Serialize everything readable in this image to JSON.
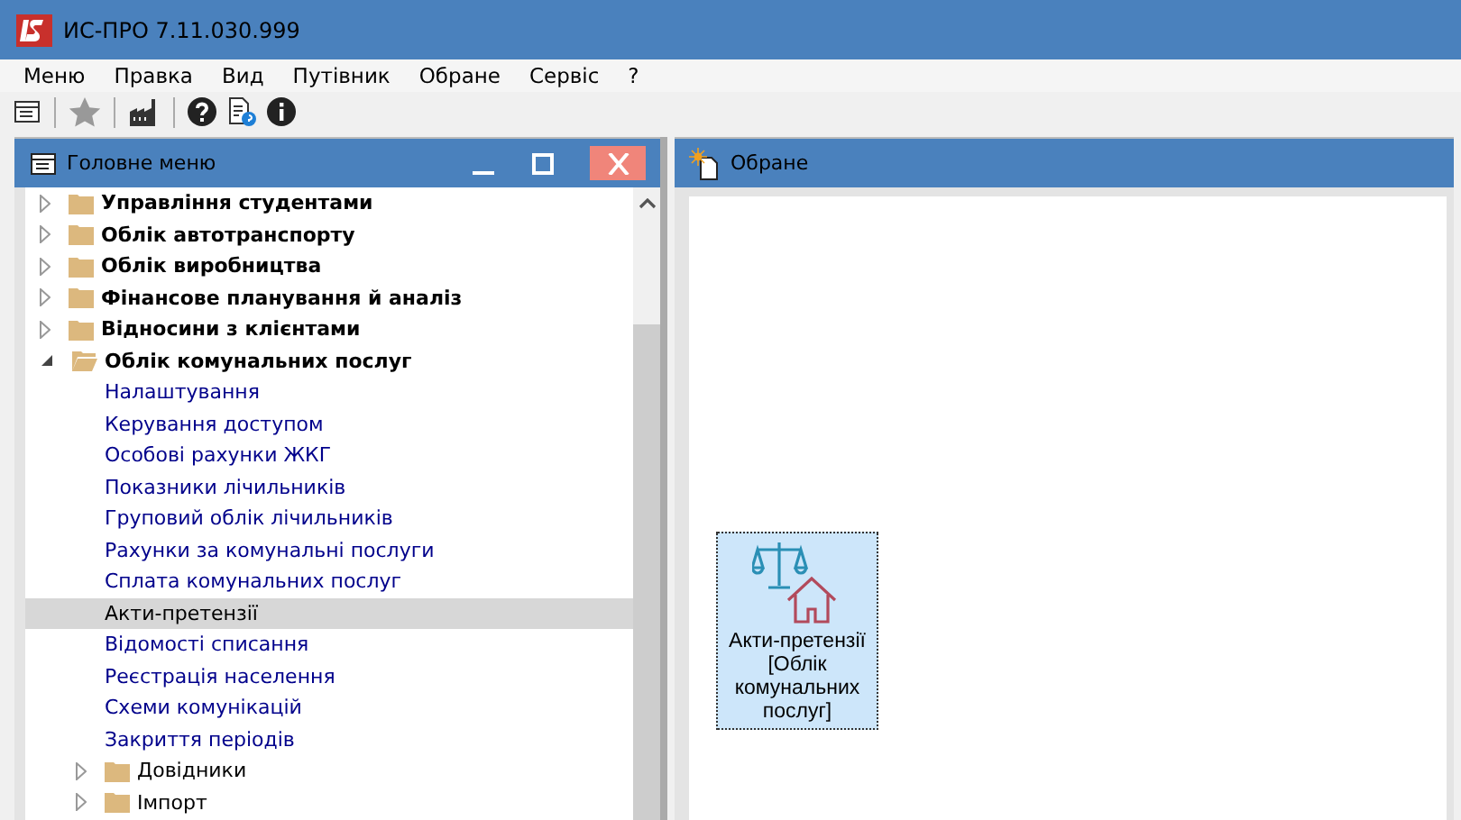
{
  "window": {
    "title": "ИС-ПРО 7.11.030.999"
  },
  "menu": [
    "Меню",
    "Правка",
    "Вид",
    "Путівник",
    "Обране",
    "Сервіс",
    "?"
  ],
  "left_panel": {
    "title": "Головне меню",
    "tree": [
      {
        "kind": "folder",
        "label": "Управління студентами",
        "expanded": false,
        "selected": false
      },
      {
        "kind": "folder",
        "label": "Облік автотранспорту",
        "expanded": false,
        "selected": false
      },
      {
        "kind": "folder",
        "label": "Облік виробництва",
        "expanded": false,
        "selected": false
      },
      {
        "kind": "folder",
        "label": "Фінансове планування й аналіз",
        "expanded": false,
        "selected": false
      },
      {
        "kind": "folder",
        "label": "Відносини з клієнтами",
        "expanded": false,
        "selected": false
      },
      {
        "kind": "folder",
        "label": "Облік комунальних послуг",
        "expanded": true,
        "selected": false,
        "children": [
          {
            "kind": "item",
            "label": "Налаштування",
            "selected": false
          },
          {
            "kind": "item",
            "label": "Керування доступом",
            "selected": false
          },
          {
            "kind": "item",
            "label": "Особові рахунки ЖКГ",
            "selected": false
          },
          {
            "kind": "item",
            "label": "Показники лічильників",
            "selected": false
          },
          {
            "kind": "item",
            "label": "Груповий облік лічильників",
            "selected": false
          },
          {
            "kind": "item",
            "label": "Рахунки за комунальні послуги",
            "selected": false
          },
          {
            "kind": "item",
            "label": "Сплата комунальних послуг",
            "selected": false
          },
          {
            "kind": "item",
            "label": "Акти-претензії",
            "selected": true
          },
          {
            "kind": "item",
            "label": "Відомості списання",
            "selected": false
          },
          {
            "kind": "item",
            "label": "Реєстрація населення",
            "selected": false
          },
          {
            "kind": "item",
            "label": "Схеми комунікацій",
            "selected": false
          },
          {
            "kind": "item",
            "label": "Закриття періодів",
            "selected": false
          },
          {
            "kind": "folder",
            "label": "Довідники",
            "expanded": false,
            "selected": false
          },
          {
            "kind": "folder",
            "label": "Імпорт",
            "expanded": false,
            "selected": false
          }
        ]
      }
    ]
  },
  "right_panel": {
    "title": "Обране",
    "tiles": [
      {
        "label": "Акти-претензії [Облік комунальних послуг]",
        "selected": true
      }
    ]
  }
}
